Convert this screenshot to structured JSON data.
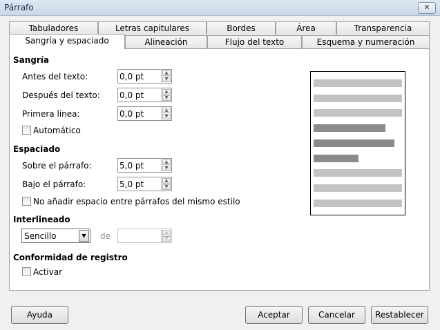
{
  "window": {
    "title": "Párrafo",
    "close_glyph": "✕"
  },
  "tabs_row1": [
    "Tabuladores",
    "Letras capitulares",
    "Bordes",
    "Área",
    "Transparencia"
  ],
  "tabs_row2": [
    "Sangría y espaciado",
    "Alineación",
    "Flujo del texto",
    "Esquema y numeración"
  ],
  "active_tab": "Sangría y espaciado",
  "sangria": {
    "heading": "Sangría",
    "antes_label": "Antes del texto:",
    "antes_value": "0,0 pt",
    "despues_label": "Después del texto:",
    "despues_value": "0,0 pt",
    "primera_label": "Primera línea:",
    "primera_value": "0,0 pt",
    "automatico_label": "Automático",
    "automatico_checked": false
  },
  "espaciado": {
    "heading": "Espaciado",
    "sobre_label": "Sobre el párrafo:",
    "sobre_value": "5,0 pt",
    "bajo_label": "Bajo el párrafo:",
    "bajo_value": "5,0 pt",
    "no_anadir_label": "No añadir espacio entre párrafos del mismo estilo",
    "no_anadir_checked": false
  },
  "interlineado": {
    "heading": "Interlineado",
    "selected": "Sencillo",
    "de_label": "de",
    "de_value": ""
  },
  "conformidad": {
    "heading": "Conformidad de registro",
    "activar_label": "Activar",
    "activar_checked": false
  },
  "preview_colors": {
    "light": "#c3c3c3",
    "dark": "#8a8a8a"
  },
  "buttons": {
    "help": "Ayuda",
    "ok": "Aceptar",
    "cancel": "Cancelar",
    "reset": "Restablecer"
  }
}
